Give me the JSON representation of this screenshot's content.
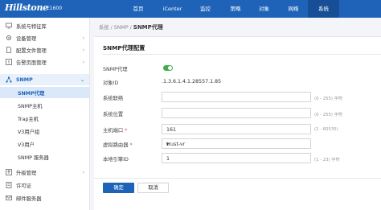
{
  "header": {
    "logo": "Hillstone",
    "model": "E1600",
    "nav": [
      {
        "label": "首页",
        "active": false
      },
      {
        "label": "iCenter",
        "active": false
      },
      {
        "label": "监控",
        "active": false
      },
      {
        "label": "策略",
        "active": false
      },
      {
        "label": "对象",
        "active": false
      },
      {
        "label": "网络",
        "active": false
      },
      {
        "label": "系统",
        "active": true
      }
    ]
  },
  "sidebar": {
    "items": [
      {
        "label": "系统与特征库",
        "icon": "monitor-icon"
      },
      {
        "label": "设备管理",
        "icon": "gear-icon"
      },
      {
        "label": "配置文件管理",
        "icon": "file-icon"
      },
      {
        "label": "告警页面管理",
        "icon": "alert-icon"
      },
      {
        "label": "SNMP",
        "icon": "network-icon"
      },
      {
        "label": "升级管理",
        "icon": "upgrade-icon"
      },
      {
        "label": "许可证",
        "icon": "license-icon"
      },
      {
        "label": "邮件服务器",
        "icon": "mail-icon"
      }
    ],
    "snmp_sub": [
      "SNMP代理",
      "SNMP主机",
      "Trap主机",
      "V3用户组",
      "V3用户",
      "SNMP 服务器"
    ]
  },
  "breadcrumb": {
    "part1": "系统",
    "sep": " / ",
    "part2": "SNMP",
    "current": "SNMP代理"
  },
  "form": {
    "title": "SNMP代理配置",
    "agent_label": "SNMP代理",
    "agent_enabled": true,
    "oid_label": "对象ID",
    "oid_value": ".1.3.6.1.4.1.28557.1.85",
    "contact_label": "系统联络",
    "contact_value": "",
    "contact_hint": "(0 - 255) 字符",
    "location_label": "系统位置",
    "location_value": "",
    "location_hint": "(0 - 255) 字符",
    "port_label": "主机端口",
    "port_value": "161",
    "port_hint": "(1 - 65535)",
    "vrouter_label": "虚拟路由器",
    "vrouter_value": "trust-vr",
    "engine_label": "本地引擎ID",
    "engine_value": "1",
    "engine_hint": "(1 - 23) 字符",
    "required_mark": "*"
  },
  "buttons": {
    "ok": "确定",
    "cancel": "取消"
  },
  "colors": {
    "primary": "#1e63b8",
    "toggle_on": "#3fae49",
    "required": "#e04a3b"
  }
}
